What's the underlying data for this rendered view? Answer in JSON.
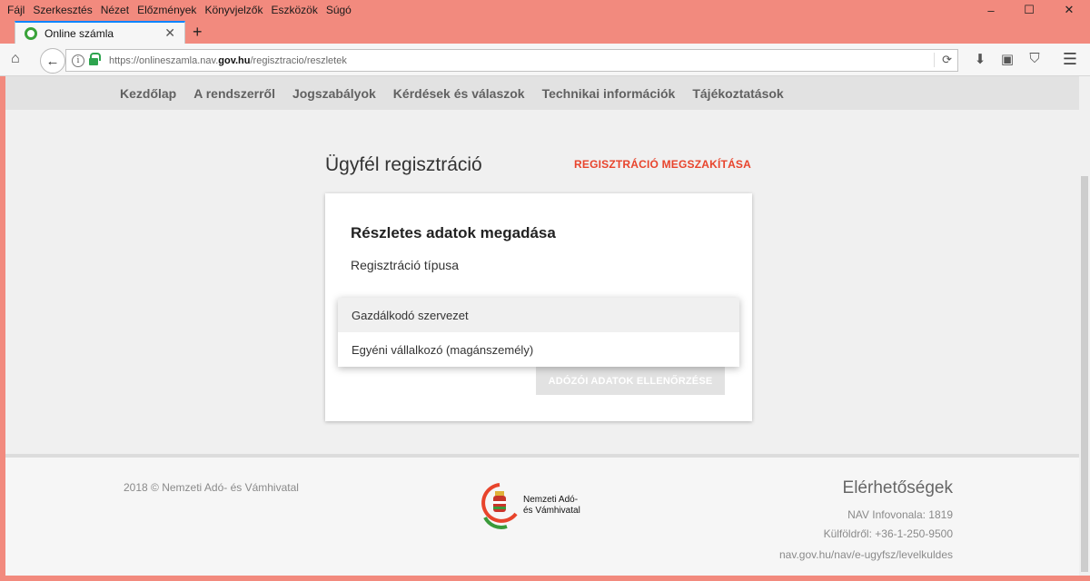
{
  "menubar": {
    "items": [
      "Fájl",
      "Szerkesztés",
      "Nézet",
      "Előzmények",
      "Könyvjelzők",
      "Eszközök",
      "Súgó"
    ]
  },
  "window_controls": {
    "minimize": "–",
    "maximize": "☐",
    "close": "✕"
  },
  "tab": {
    "title": "Online számla",
    "close": "✕",
    "new_tab": "+"
  },
  "urlbar": {
    "url_prefix": "https://onlineszamla.nav.",
    "url_domain": "gov.hu",
    "url_path": "/regisztracio/reszletek"
  },
  "site_nav": {
    "items": [
      "Kezdőlap",
      "A rendszerről",
      "Jogszabályok",
      "Kérdések és válaszok",
      "Technikai információk",
      "Tájékoztatások"
    ]
  },
  "page": {
    "title": "Ügyfél regisztráció",
    "abort_link": "REGISZTRÁCIÓ MEGSZAKÍTÁSA"
  },
  "card": {
    "title": "Részletes adatok megadása",
    "subtitle": "Regisztráció típusa",
    "verify_button": "ADÓZÓI ADATOK ELLENŐRZÉSE"
  },
  "dropdown": {
    "options": [
      "Gazdálkodó szervezet",
      "Egyéni vállalkozó (magánszemély)"
    ]
  },
  "footer": {
    "copyright": "2018 © Nemzeti Adó- és Vámhivatal",
    "logo_line1": "Nemzeti Adó-",
    "logo_line2": "és Vámhivatal",
    "contact_title": "Elérhetőségek",
    "contact_infoline": "NAV Infovonala: 1819",
    "contact_abroad": "Külföldről: +36-1-250-9500",
    "contact_link": "nav.gov.hu/nav/e-ugyfsz/levelkuldes"
  },
  "colors": {
    "window_frame": "#f28a7e",
    "accent_red": "#e8442c",
    "tab_accent": "#0a84ff",
    "lock_green": "#2da44e"
  }
}
